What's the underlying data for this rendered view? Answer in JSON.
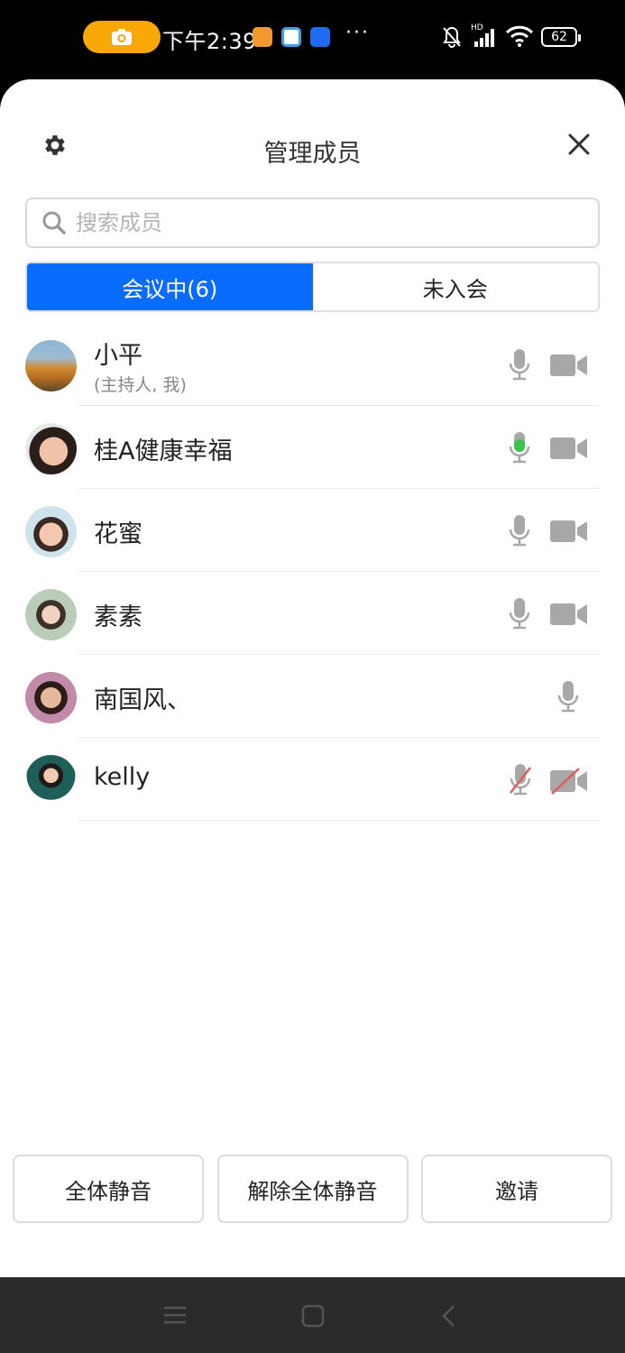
{
  "status_bar": {
    "time": "下午2:39",
    "battery": "62",
    "signal_badge": "HD"
  },
  "header": {
    "title": "管理成员"
  },
  "search": {
    "placeholder": "搜索成员"
  },
  "tabs": [
    {
      "label": "会议中(6)",
      "active": true
    },
    {
      "label": "未入会",
      "active": false
    }
  ],
  "members": [
    {
      "name": "小平",
      "role": "(主持人, 我)",
      "mic": "on",
      "camera": "on"
    },
    {
      "name": "桂A健康幸福",
      "role": "",
      "mic": "speaking",
      "camera": "on"
    },
    {
      "name": "花蜜",
      "role": "",
      "mic": "on",
      "camera": "on"
    },
    {
      "name": "素素",
      "role": "",
      "mic": "on",
      "camera": "on"
    },
    {
      "name": "南国风、",
      "role": "",
      "mic": "on",
      "camera": "none"
    },
    {
      "name": "kelly",
      "role": "",
      "mic": "muted",
      "camera": "off"
    }
  ],
  "actions": {
    "mute_all": "全体静音",
    "unmute_all": "解除全体静音",
    "invite": "邀请"
  },
  "colors": {
    "accent": "#0a6cff",
    "icon_gray": "#a8a8a8",
    "speaking_green": "#3bc34a",
    "muted_red": "#e25b5b"
  }
}
